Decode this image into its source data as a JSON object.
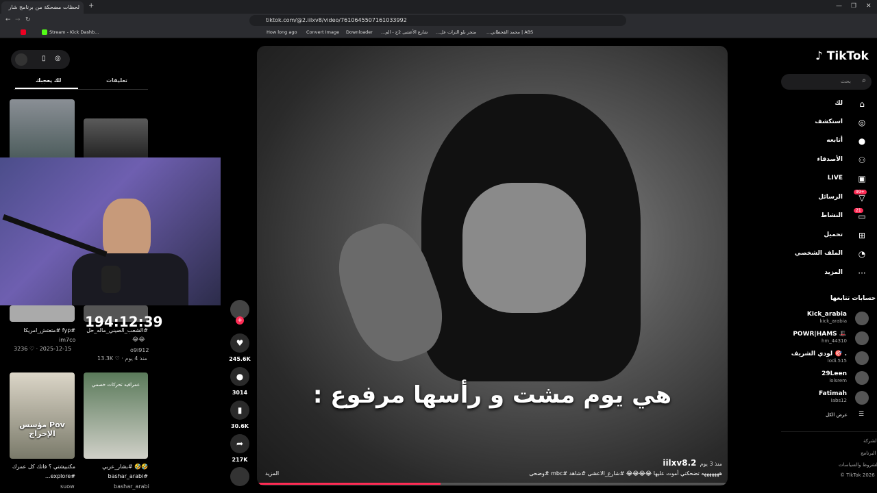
{
  "browser": {
    "tab_title": "لحظات مضحكة من برنامج شار",
    "new_tab": "+",
    "url": "tiktok.com/@2.iilxv8/video/7610645507161033992",
    "bookmarks": [
      "Stream - Kick Dashb...",
      "How long ago",
      "Convert Image",
      "Downloader",
      "شارع الأعشى 2ج - الم...",
      "متجر بلو الترات عل...",
      "ABS | محمد القحطاني..."
    ]
  },
  "left_panel": {
    "tabs": [
      "لك يعجبك",
      "تعليقات"
    ],
    "videos": [
      {
        "caption": "#fyp #متعتش_امريكا",
        "author": "im7co",
        "meta": "3236 ♡ · 2025-12-15"
      },
      {
        "caption": "#الشعب_الصيني_ماله_حل",
        "emoji": "😂😂",
        "author": "o9i912",
        "meta": "13.3K ♡ · منذ 4 يوم"
      },
      {
        "caption": "مكتبيشتي ؟ فاتك كل عمرك",
        "caption2": "#explore...",
        "author": "suow",
        "overlay": "Pov مؤسس الإحراج"
      },
      {
        "caption": "🤣🤣 #بشار_عربي",
        "caption2": "#bashar_arabi",
        "author": "bashar_arabi",
        "overlay": "عمرافيد تحركات خصمي"
      }
    ]
  },
  "stream": {
    "timer": "194:12:39"
  },
  "video": {
    "subtitle": "هي يوم مشت و رأسها مرفوع :",
    "author": "iilxv8.2",
    "posted": "منذ 3 يوم",
    "description": "هههههههه تضحكني أموت عليها 😂😂😂😂 #شارع_الاعشى #شاهد #mbc #وضحى",
    "more": "المزيد",
    "progress_fraction": 0.39
  },
  "actions": {
    "likes": "245.6K",
    "comments": "3014",
    "saves": "30.6K",
    "shares": "217K"
  },
  "nav": {
    "logo": "TikTok",
    "search_placeholder": "بحث",
    "items": [
      {
        "label": "لك",
        "icon": "home-icon"
      },
      {
        "label": "استكشف",
        "icon": "compass-icon"
      },
      {
        "label": "أتابعه",
        "icon": "following-avatar-icon"
      },
      {
        "label": "الأصدقاء",
        "icon": "friends-icon"
      },
      {
        "label": "LIVE",
        "icon": "live-icon"
      },
      {
        "label": "الرسائل",
        "icon": "inbox-icon",
        "badge": "99+"
      },
      {
        "label": "النشاط",
        "icon": "activity-icon",
        "badge": "21"
      },
      {
        "label": "تحميل",
        "icon": "upload-icon"
      },
      {
        "label": "الملف الشخصي",
        "icon": "profile-icon"
      },
      {
        "label": "المزيد",
        "icon": "more-icon"
      }
    ],
    "following_title": "حسابات تتابعها",
    "following": [
      {
        "name": "Kick_arabia",
        "handle": "kick_arabia"
      },
      {
        "name": "POWR|HAMS 🎩",
        "handle": "hm_44310"
      },
      {
        "name": "لودي الشريف 🎯 .",
        "handle": "lodi.515"
      },
      {
        "name": "29Leen",
        "handle": "lolsrem"
      },
      {
        "name": "Fatimah",
        "handle": "iabs12"
      }
    ],
    "see_all": "عرض الكل",
    "footer": [
      "الشركة",
      "البرنامج",
      "الشروط والسياسات",
      "© TikTok 2026"
    ]
  },
  "colors": {
    "accent": "#fe2c55",
    "bg": "#000000",
    "panel": "#1d1d1f"
  }
}
